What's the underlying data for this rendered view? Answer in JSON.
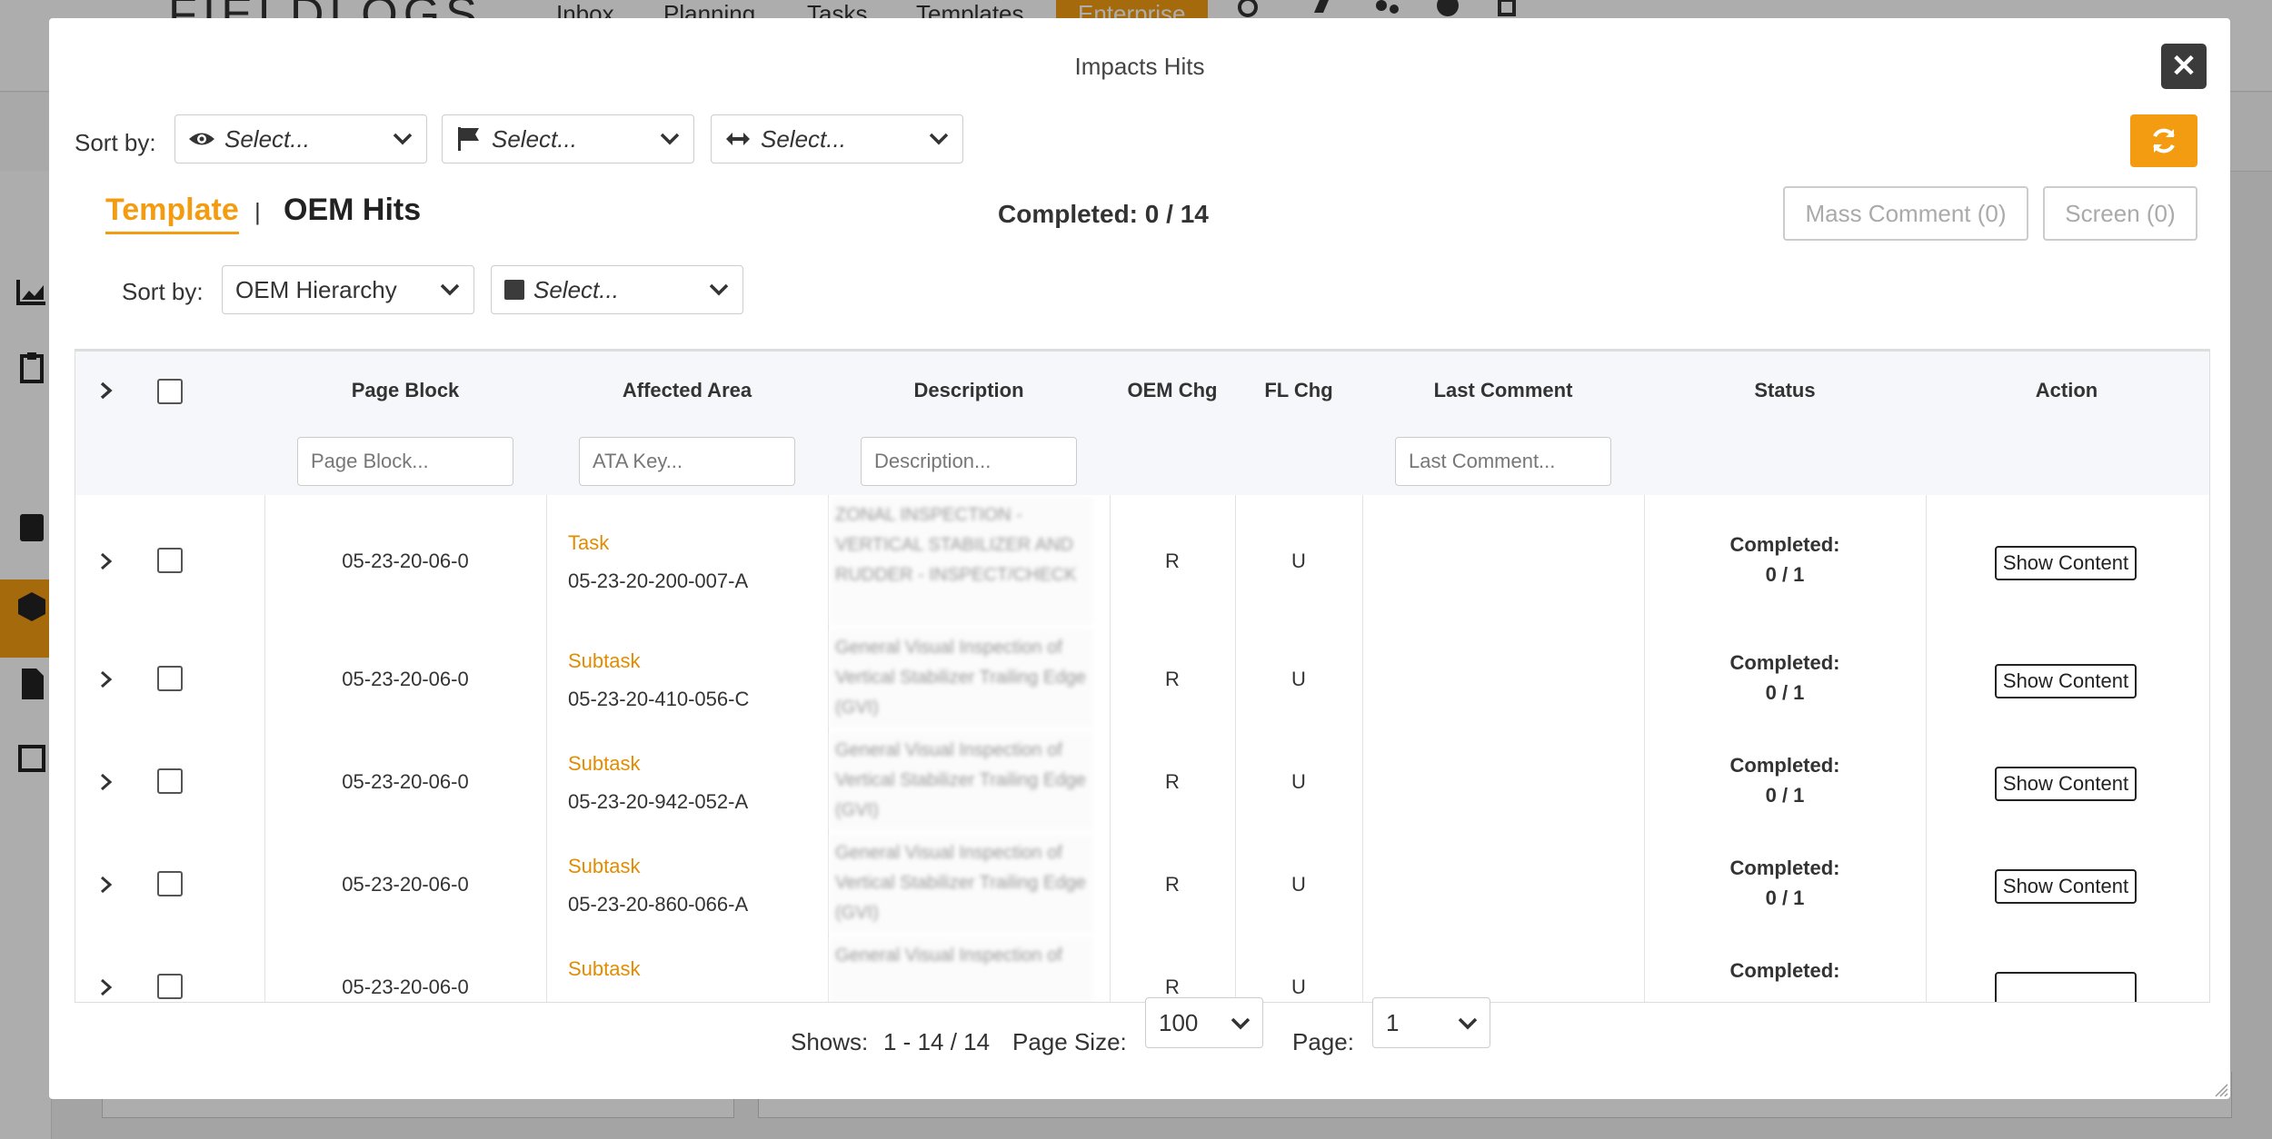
{
  "background": {
    "logo": "FIELDLOGS",
    "nav": [
      "Inbox",
      "Planning",
      "Tasks",
      "Templates",
      "Enterprise"
    ]
  },
  "modal": {
    "title": "Impacts Hits",
    "sort_label": "Sort by:",
    "top_selects": [
      {
        "icon": "eye-icon",
        "placeholder": "Select..."
      },
      {
        "icon": "flag-icon",
        "placeholder": "Select..."
      },
      {
        "icon": "arrows-horizontal-icon",
        "placeholder": "Select..."
      }
    ],
    "tabs": {
      "template": "Template",
      "separator": "|",
      "oem_hits": "OEM Hits"
    },
    "completed_summary": "Completed: 0 / 14",
    "mass_comment_label": "Mass Comment (0)",
    "screen_label": "Screen (0)",
    "inner_sort_label": "Sort by:",
    "hierarchy_select": "OEM Hierarchy",
    "square_select_placeholder": "Select..."
  },
  "table": {
    "headers": {
      "page_block": "Page Block",
      "affected_area": "Affected Area",
      "description": "Description",
      "oem_chg": "OEM Chg",
      "fl_chg": "FL Chg",
      "last_comment": "Last Comment",
      "status": "Status",
      "action": "Action"
    },
    "filters": {
      "page_block": "Page Block...",
      "ata_key": "ATA Key...",
      "description": "Description...",
      "last_comment": "Last Comment..."
    },
    "rows": [
      {
        "page_block": "05-23-20-06-0",
        "type": "Task",
        "ata": "05-23-20-200-007-A",
        "description": "ZONAL INSPECTION - VERTICAL STABILIZER AND RUDDER - INSPECT/CHECK",
        "oem_chg": "R",
        "fl_chg": "U",
        "status_label": "Completed:",
        "status_value": "0 / 1",
        "action": "Show Content"
      },
      {
        "page_block": "05-23-20-06-0",
        "type": "Subtask",
        "ata": "05-23-20-410-056-C",
        "description": "General Visual Inspection of Vertical Stabilizer Trailing Edge (GVI)",
        "oem_chg": "R",
        "fl_chg": "U",
        "status_label": "Completed:",
        "status_value": "0 / 1",
        "action": "Show Content"
      },
      {
        "page_block": "05-23-20-06-0",
        "type": "Subtask",
        "ata": "05-23-20-942-052-A",
        "description": "General Visual Inspection of Vertical Stabilizer Trailing Edge (GVI)",
        "oem_chg": "R",
        "fl_chg": "U",
        "status_label": "Completed:",
        "status_value": "0 / 1",
        "action": "Show Content"
      },
      {
        "page_block": "05-23-20-06-0",
        "type": "Subtask",
        "ata": "05-23-20-860-066-A",
        "description": "General Visual Inspection of Vertical Stabilizer Trailing Edge (GVI)",
        "oem_chg": "R",
        "fl_chg": "U",
        "status_label": "Completed:",
        "status_value": "0 / 1",
        "action": "Show Content"
      },
      {
        "page_block": "05-23-20-06-0",
        "type": "Subtask",
        "ata": "",
        "description": "General Visual Inspection of",
        "oem_chg": "R",
        "fl_chg": "U",
        "status_label": "Completed:",
        "status_value": "",
        "action": ""
      }
    ]
  },
  "pagination": {
    "shows_label": "Shows:",
    "shows_value": "1 - 14 / 14",
    "page_size_label": "Page Size:",
    "page_size_value": "100",
    "page_label": "Page:",
    "page_value": "1"
  },
  "colors": {
    "accent": "#f39c12",
    "dark": "#3b3b3b"
  }
}
